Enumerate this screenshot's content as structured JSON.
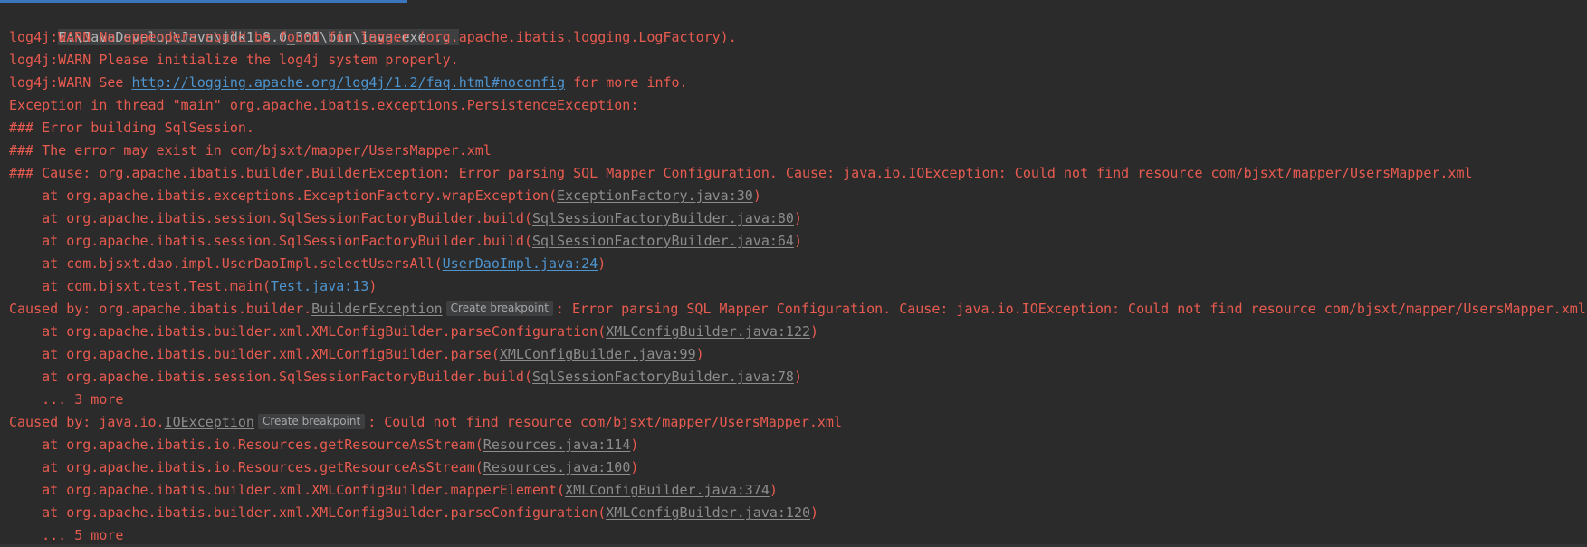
{
  "console": {
    "command": "E:\\JavaDevelop\\Java\\jdk1.8.0_301\\bin\\java.exe ...",
    "breakpoint_label": "Create breakpoint",
    "warn1": "log4j:WARN No appenders could be found for logger (org.apache.ibatis.logging.LogFactory).",
    "warn2": "log4j:WARN Please initialize the log4j system properly.",
    "warn3_prefix": "log4j:WARN See ",
    "warn3_link": "http://logging.apache.org/log4j/1.2/faq.html#noconfig",
    "warn3_suffix": " for more info.",
    "exception_line": "Exception in thread \"main\" org.apache.ibatis.exceptions.PersistenceException: ",
    "error_building": "### Error building SqlSession.",
    "error_exist": "### The error may exist in com/bjsxt/mapper/UsersMapper.xml",
    "error_cause": "### Cause: org.apache.ibatis.builder.BuilderException: Error parsing SQL Mapper Configuration. Cause: java.io.IOException: Could not find resource com/bjsxt/mapper/UsersMapper.xml",
    "trace1": [
      {
        "prefix": "    at org.apache.ibatis.exceptions.ExceptionFactory.wrapException(",
        "link": "ExceptionFactory.java:30",
        "suffix": ")",
        "link_color": "gray"
      },
      {
        "prefix": "    at org.apache.ibatis.session.SqlSessionFactoryBuilder.build(",
        "link": "SqlSessionFactoryBuilder.java:80",
        "suffix": ")",
        "link_color": "gray"
      },
      {
        "prefix": "    at org.apache.ibatis.session.SqlSessionFactoryBuilder.build(",
        "link": "SqlSessionFactoryBuilder.java:64",
        "suffix": ")",
        "link_color": "gray"
      },
      {
        "prefix": "    at com.bjsxt.dao.impl.UserDaoImpl.selectUsersAll(",
        "link": "UserDaoImpl.java:24",
        "suffix": ")",
        "link_color": "blue"
      },
      {
        "prefix": "    at com.bjsxt.test.Test.main(",
        "link": "Test.java:13",
        "suffix": ")",
        "link_color": "blue"
      }
    ],
    "caused1": {
      "prefix": "Caused by: org.apache.ibatis.builder.",
      "link": "BuilderException",
      "suffix": ": Error parsing SQL Mapper Configuration. Cause: java.io.IOException: Could not find resource com/bjsxt/mapper/UsersMapper.xml"
    },
    "trace2": [
      {
        "prefix": "    at org.apache.ibatis.builder.xml.XMLConfigBuilder.parseConfiguration(",
        "link": "XMLConfigBuilder.java:122",
        "suffix": ")",
        "link_color": "gray"
      },
      {
        "prefix": "    at org.apache.ibatis.builder.xml.XMLConfigBuilder.parse(",
        "link": "XMLConfigBuilder.java:99",
        "suffix": ")",
        "link_color": "gray"
      },
      {
        "prefix": "    at org.apache.ibatis.session.SqlSessionFactoryBuilder.build(",
        "link": "SqlSessionFactoryBuilder.java:78",
        "suffix": ")",
        "link_color": "gray"
      }
    ],
    "more1": "    ... 3 more",
    "caused2": {
      "prefix": "Caused by: java.io.",
      "link": "IOException",
      "suffix": ": Could not find resource com/bjsxt/mapper/UsersMapper.xml"
    },
    "trace3": [
      {
        "prefix": "    at org.apache.ibatis.io.Resources.getResourceAsStream(",
        "link": "Resources.java:114",
        "suffix": ")",
        "link_color": "gray"
      },
      {
        "prefix": "    at org.apache.ibatis.io.Resources.getResourceAsStream(",
        "link": "Resources.java:100",
        "suffix": ")",
        "link_color": "gray"
      },
      {
        "prefix": "    at org.apache.ibatis.builder.xml.XMLConfigBuilder.mapperElement(",
        "link": "XMLConfigBuilder.java:374",
        "suffix": ")",
        "link_color": "gray"
      },
      {
        "prefix": "    at org.apache.ibatis.builder.xml.XMLConfigBuilder.parseConfiguration(",
        "link": "XMLConfigBuilder.java:120",
        "suffix": ")",
        "link_color": "gray"
      }
    ],
    "more2": "    ... 5 more"
  },
  "colors": {
    "background": "#2b2b2b",
    "error_text": "#e85b50",
    "plain_text": "#b6b6b6",
    "link_blue": "#4e94ce",
    "link_gray": "#8c8c8c",
    "chip_bg": "#3d3f41"
  }
}
